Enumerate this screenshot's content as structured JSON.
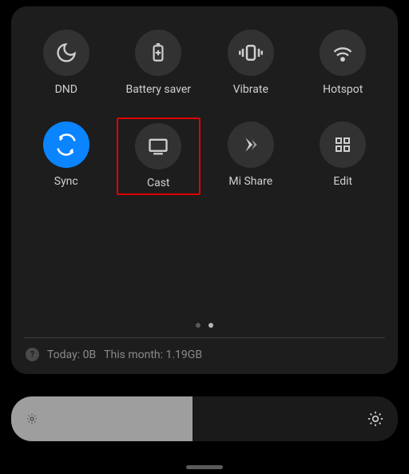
{
  "tiles": [
    {
      "id": "dnd",
      "label": "DND",
      "icon": "moon",
      "active": false
    },
    {
      "id": "battery-saver",
      "label": "Battery saver",
      "icon": "battery-plus",
      "active": false
    },
    {
      "id": "vibrate",
      "label": "Vibrate",
      "icon": "vibrate",
      "active": false
    },
    {
      "id": "hotspot",
      "label": "Hotspot",
      "icon": "hotspot",
      "active": false
    },
    {
      "id": "sync",
      "label": "Sync",
      "icon": "sync",
      "active": true
    },
    {
      "id": "cast",
      "label": "Cast",
      "icon": "cast",
      "active": false,
      "highlight": true
    },
    {
      "id": "mi-share",
      "label": "Mi Share",
      "icon": "mishare",
      "active": false
    },
    {
      "id": "edit",
      "label": "Edit",
      "icon": "grid",
      "active": false
    }
  ],
  "pagination": {
    "total": 2,
    "current": 1
  },
  "usage": {
    "today_label": "Today:",
    "today_value": "0B",
    "month_label": "This month:",
    "month_value": "1.19GB"
  },
  "brightness": {
    "percent": 47
  },
  "colors": {
    "accent": "#0a84ff",
    "highlight": "#e10000"
  }
}
